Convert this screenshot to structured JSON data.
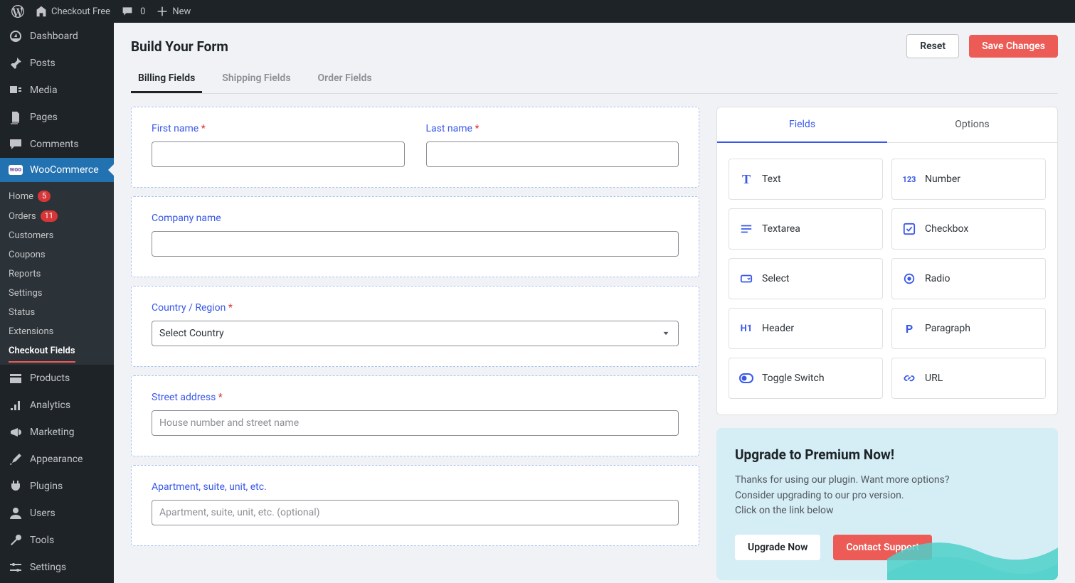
{
  "adminbar": {
    "site_title": "Checkout Free",
    "comments_count": "0",
    "new_label": "New"
  },
  "sidebar": {
    "items": [
      {
        "label": "Dashboard"
      },
      {
        "label": "Posts"
      },
      {
        "label": "Media"
      },
      {
        "label": "Pages"
      },
      {
        "label": "Comments"
      },
      {
        "label": "WooCommerce"
      },
      {
        "label": "Products"
      },
      {
        "label": "Analytics"
      },
      {
        "label": "Marketing"
      },
      {
        "label": "Appearance"
      },
      {
        "label": "Plugins"
      },
      {
        "label": "Users"
      },
      {
        "label": "Tools"
      },
      {
        "label": "Settings"
      }
    ],
    "woo_sub": {
      "home": "Home",
      "home_badge": "5",
      "orders": "Orders",
      "orders_badge": "11",
      "customers": "Customers",
      "coupons": "Coupons",
      "reports": "Reports",
      "settings": "Settings",
      "status": "Status",
      "extensions": "Extensions",
      "checkout_fields": "Checkout Fields"
    }
  },
  "page": {
    "title": "Build Your Form",
    "reset": "Reset",
    "save": "Save Changes"
  },
  "tabs": [
    "Billing Fields",
    "Shipping Fields",
    "Order Fields"
  ],
  "fields": {
    "first_name": "First name",
    "last_name": "Last name",
    "company": "Company name",
    "country": "Country / Region",
    "country_placeholder": "Select Country",
    "street": "Street address",
    "street_placeholder": "House number and street name",
    "apt": "Apartment, suite, unit, etc.",
    "apt_placeholder": "Apartment, suite, unit, etc. (optional)"
  },
  "right_tabs": [
    "Fields",
    "Options"
  ],
  "field_types": {
    "text": "Text",
    "number": "Number",
    "textarea": "Textarea",
    "checkbox": "Checkbox",
    "select": "Select",
    "radio": "Radio",
    "header": "Header",
    "paragraph": "Paragraph",
    "toggle": "Toggle Switch",
    "url": "URL"
  },
  "upgrade": {
    "title": "Upgrade to Premium Now!",
    "text1": "Thanks for using our plugin. Want more options?",
    "text2": "Consider upgrading to our pro version.",
    "text3": "Click on the link below",
    "btn1": "Upgrade Now",
    "btn2": "Contact Support"
  }
}
